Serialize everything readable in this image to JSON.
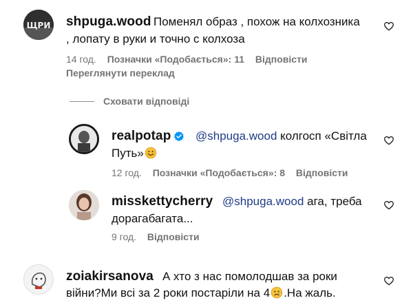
{
  "comments": [
    {
      "username": "shpuga.wood",
      "text_line1": "Поменял образ , похож на колхозника",
      "text_line2": ", лопату в руки и точно с колхоза",
      "time": "14 год.",
      "likes": "Позначки «Подобається»: 11",
      "reply": "Відповісти",
      "see_translation": "Переглянути переклад",
      "hide_replies": "Сховати відповіді"
    },
    {
      "username": "realpotap",
      "mention": "@shpuga.wood",
      "text_line1_rest": "колгосп «Світла",
      "text_line2": "Путь»",
      "time": "12 год.",
      "likes": "Позначки «Подобається»: 8",
      "reply": "Відповісти"
    },
    {
      "username": "misskettycherry",
      "mention": "@shpuga.wood",
      "text_line1_rest": "ага, треба",
      "text_line2": "дорагабагата...",
      "time": "9 год.",
      "reply": "Відповісти"
    },
    {
      "username": "zoiakirsanova",
      "text_line1": "А хто з нас помолодшав за роки",
      "text_line2_a": "війни?Ми всі за 2 роки постаріли на 4",
      "text_line2_b": ".На жаль."
    }
  ],
  "colors": {
    "text": "#111111",
    "secondary": "#737373",
    "mention": "#1f3b86",
    "verified": "#0095f6"
  },
  "icons": [
    "heart-icon",
    "verified-badge-icon",
    "sad-emoji-icon",
    "smile-emoji-icon"
  ]
}
